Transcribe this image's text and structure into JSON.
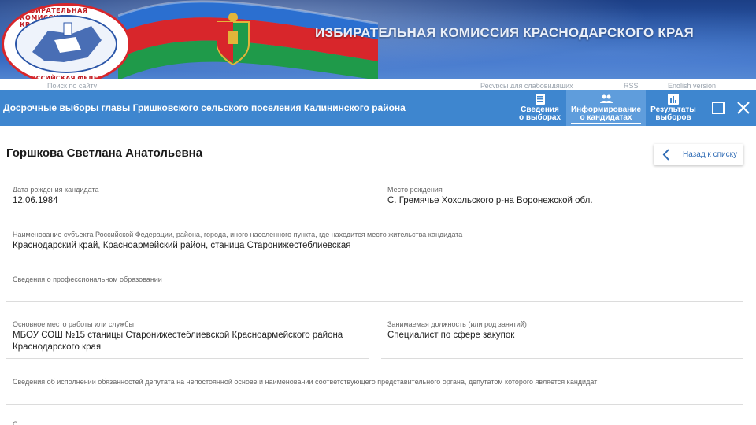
{
  "header": {
    "title": "ИЗБИРАТЕЛЬНАЯ КОМИССИЯ КРАСНОДАРСКОГО КРАЯ",
    "emblem_text_top": "ИЗБИРАТЕЛЬНАЯ КОМИССИЯ КРАСНОДАРСКОГО",
    "emblem_text_bottom": "РОССИЙСКАЯ ФЕДЕРАЦИЯ",
    "strip_items": [
      "Поиск по сайту",
      "Ресурсы для слабовидящих",
      "RSS",
      "English version"
    ]
  },
  "modal": {
    "title": "Досрочные выборы главы Гришковского сельского поселения Калининского района",
    "tabs": [
      {
        "line1": "Сведения",
        "line2": "о выборах",
        "icon": "document-icon",
        "active": false
      },
      {
        "line1": "Информирование",
        "line2": "о кандидатах",
        "icon": "people-icon",
        "active": true
      },
      {
        "line1": "Результаты",
        "line2": "выборов",
        "icon": "bar-chart-icon",
        "active": false
      }
    ],
    "maximize_icon": "square-icon",
    "close_icon": "close-icon"
  },
  "candidate": {
    "name": "Горшкова Светлана Анатольевна",
    "back_label": "Назад к списку"
  },
  "fields": {
    "birth_date": {
      "label": "Дата рождения кандидата",
      "value": "12.06.1984"
    },
    "birth_place": {
      "label": "Место рождения",
      "value": "С. Гремячье Хохольского р-на Воронежской обл."
    },
    "residence": {
      "label": "Наименование субъекта Российской Федерации, района, города, иного населенного пункта, где находится место жительства кандидата",
      "value": "Краснодарский край, Красноармейский район, станица Старонижестеблиевская"
    },
    "education": {
      "label": "Сведения о профессиональном образовании",
      "value": ""
    },
    "workplace": {
      "label": "Основное место работы или службы",
      "value_line1": "МБОУ СОШ №15 станицы Старонижестеблиевской Красноармейского района",
      "value_line2": "Краснодарского края"
    },
    "position": {
      "label": "Занимаемая должность (или род занятий)",
      "value": "Специалист по сфере закупок"
    },
    "deputy": {
      "label": "Сведения об исполнении обязанностей депутата на непостоянной основе и наименовании соответствующего представительного органа, депутатом которого является кандидат",
      "value": ""
    },
    "next_label": "С"
  },
  "colors": {
    "bar": "#3e86cf",
    "active_tab": "#5f9ddc",
    "flag_red": "#d8262b",
    "flag_green": "#1f9a4a",
    "flag_blue": "#2b6fd0"
  }
}
